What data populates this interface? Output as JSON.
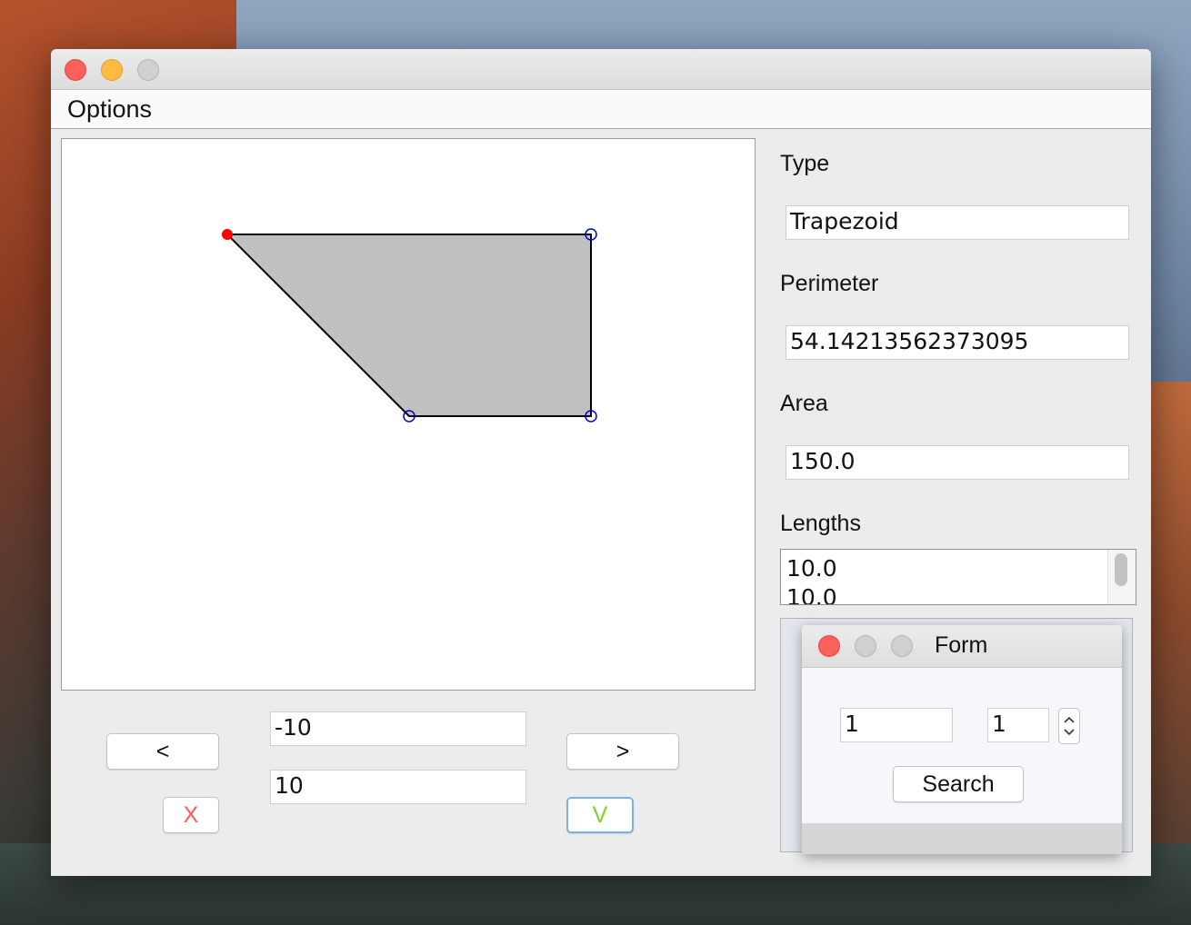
{
  "menubar": {
    "options_label": "Options"
  },
  "panel": {
    "type_label": "Type",
    "type_value": "Trapezoid",
    "perimeter_label": "Perimeter",
    "perimeter_value": "54.14213562373095",
    "area_label": "Area",
    "area_value": "150.0",
    "lengths_label": "Lengths",
    "lengths": [
      "10.0",
      "10.0"
    ]
  },
  "controls": {
    "prev_label": "<",
    "next_label": ">",
    "x_value": "-10",
    "y_value": "10",
    "cancel_label": "X",
    "cancel_color": "#ff5a5a",
    "confirm_label": "V",
    "confirm_color": "#7ed321"
  },
  "shape": {
    "type": "trapezoid",
    "fill": "#c0c0c0",
    "selected_vertex_color": "#ff0000",
    "vertex_color": "#0000cc"
  },
  "form": {
    "title": "Form",
    "field1_value": "1",
    "spinner_value": "1",
    "search_label": "Search"
  }
}
